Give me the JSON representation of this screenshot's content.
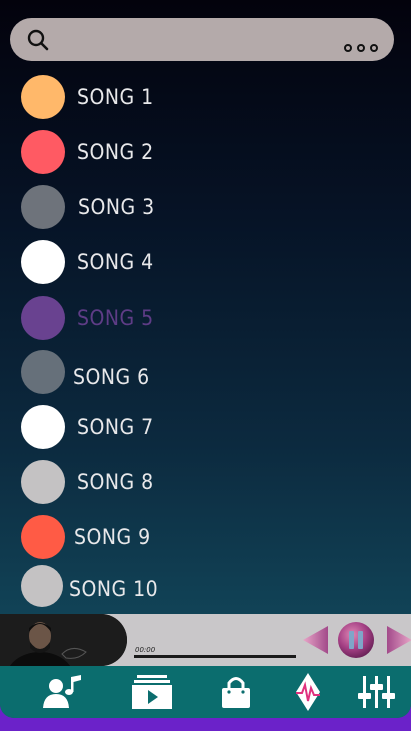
{
  "search": {
    "icon": "search-icon",
    "more_icon": "more-options-icon"
  },
  "songs": [
    {
      "label": "SONG 1",
      "color": "#ffb86a"
    },
    {
      "label": "SONG 2",
      "color": "#ff5a63"
    },
    {
      "label": "SONG 3",
      "color": "#6e737b"
    },
    {
      "label": "SONG 4",
      "color": "#ffffff"
    },
    {
      "label": "SONG 5",
      "color": "#694290"
    },
    {
      "label": "SONG 6",
      "color": "#66707a"
    },
    {
      "label": "SONG 7",
      "color": "#ffffff"
    },
    {
      "label": "SONG 8",
      "color": "#c4c2c3"
    },
    {
      "label": "SONG 9",
      "color": "#ff5b45"
    },
    {
      "label": "SONG 10",
      "color": "#c4c2c3"
    }
  ],
  "player": {
    "elapsed": "00:00",
    "progress": 0,
    "prev_icon": "previous-icon",
    "pause_icon": "pause-icon",
    "next_icon": "next-icon"
  },
  "nav": [
    {
      "icon": "artists-icon"
    },
    {
      "icon": "playlist-icon"
    },
    {
      "icon": "store-icon"
    },
    {
      "icon": "waveform-icon"
    },
    {
      "icon": "equalizer-icon"
    }
  ],
  "colors": {
    "accent": "#a23f83",
    "nav_bg": "#0b6d6e",
    "frame": "#6b22c9"
  }
}
